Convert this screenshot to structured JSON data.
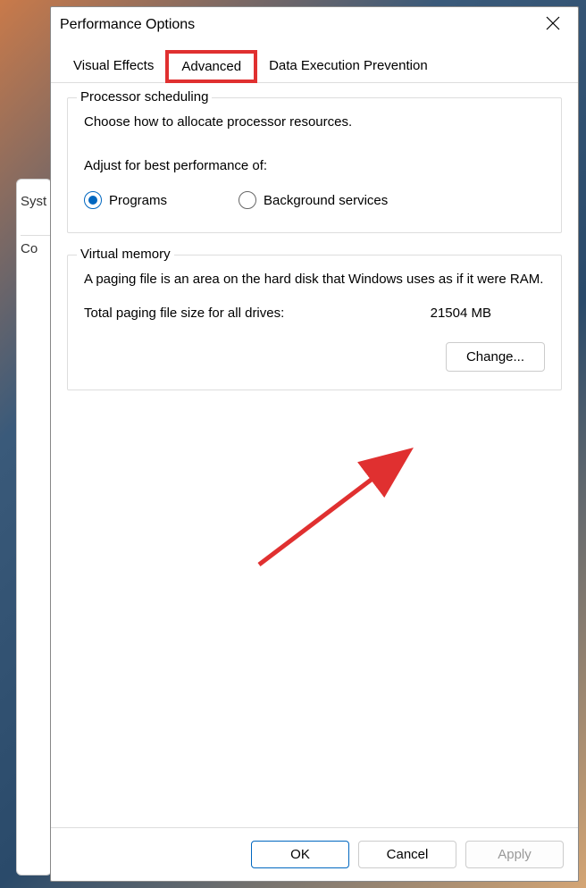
{
  "background": {
    "label1": "Syst",
    "label2": "Co"
  },
  "dialog": {
    "title": "Performance Options",
    "tabs": {
      "visual_effects": "Visual Effects",
      "advanced": "Advanced",
      "dep": "Data Execution Prevention"
    },
    "processor_scheduling": {
      "title": "Processor scheduling",
      "description": "Choose how to allocate processor resources.",
      "adjust_label": "Adjust for best performance of:",
      "option_programs": "Programs",
      "option_background": "Background services"
    },
    "virtual_memory": {
      "title": "Virtual memory",
      "description": "A paging file is an area on the hard disk that Windows uses as if it were RAM.",
      "total_label": "Total paging file size for all drives:",
      "total_value": "21504 MB",
      "change_button": "Change..."
    },
    "buttons": {
      "ok": "OK",
      "cancel": "Cancel",
      "apply": "Apply"
    }
  }
}
